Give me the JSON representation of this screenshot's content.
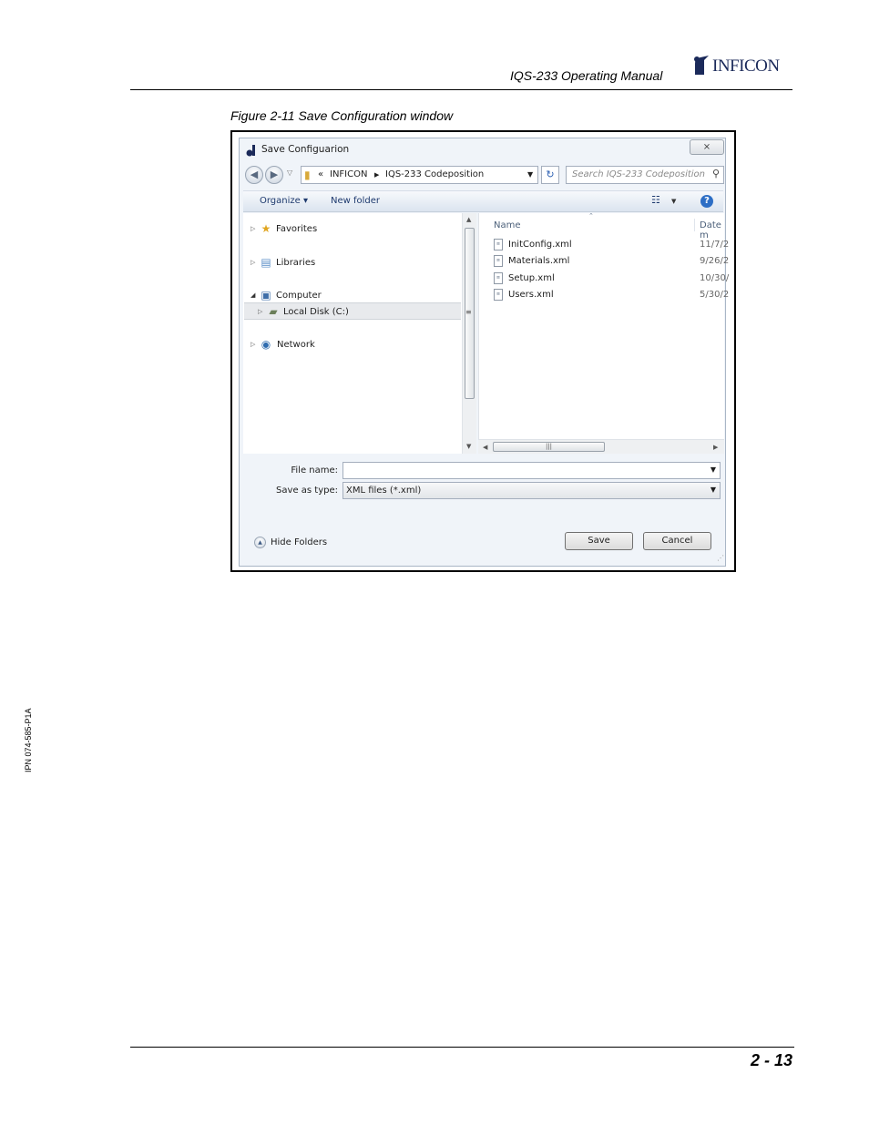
{
  "header": {
    "manual_title": "IQS-233 Operating Manual",
    "logo_text": "INFICON"
  },
  "caption": "Figure 2-11  Save Configuration window",
  "dialog": {
    "title": "Save Configuarion",
    "close_symbol": "⨯",
    "address": {
      "overflow": "«",
      "crumb1": "INFICON",
      "crumb2": "IQS-233 Codeposition"
    },
    "search_placeholder": "Search IQS-233 Codeposition",
    "toolbar": {
      "organize": "Organize ▾",
      "new_folder": "New folder",
      "help": "?"
    },
    "nav": {
      "favorites": "Favorites",
      "libraries": "Libraries",
      "computer": "Computer",
      "local_disk": "Local Disk (C:)",
      "network": "Network"
    },
    "columns": {
      "name": "Name",
      "date": "Date m"
    },
    "files": [
      {
        "name": "InitConfig.xml",
        "date": "11/7/2"
      },
      {
        "name": "Materials.xml",
        "date": "9/26/2"
      },
      {
        "name": "Setup.xml",
        "date": "10/30/"
      },
      {
        "name": "Users.xml",
        "date": "5/30/2"
      }
    ],
    "form": {
      "file_name_label": "File name:",
      "file_name_value": "",
      "save_as_type_label": "Save as type:",
      "save_as_type_value": "XML files (*.xml)"
    },
    "hide_folders": "Hide Folders",
    "save_button": "Save",
    "cancel_button": "Cancel"
  },
  "side_text": "IPN 074-585-P1A",
  "page_number": "2 - 13"
}
